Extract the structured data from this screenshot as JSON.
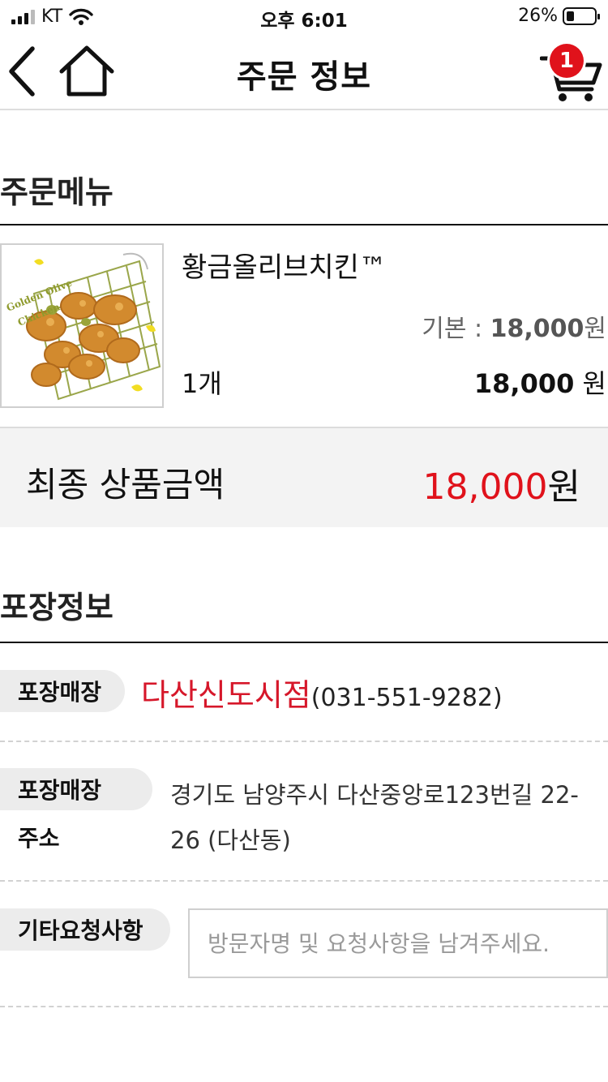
{
  "status_bar": {
    "carrier": "KT",
    "time": "오후 6:01",
    "battery_percent": "26%",
    "battery_level": 0.26
  },
  "header": {
    "title": "주문 정보",
    "cart_count": "1",
    "icons": {
      "back": "chevron-left-icon",
      "home": "home-icon",
      "cart": "cart-icon"
    }
  },
  "order_menu": {
    "title": "주문메뉴",
    "item": {
      "image_text_line1": "Golden Olive",
      "image_text_line2": "Chicken",
      "name": "황금올리브치킨™",
      "base_label": "기본 : ",
      "base_price": "18,000",
      "base_unit": "원",
      "quantity": "1개",
      "price": "18,000",
      "price_unit": " 원"
    }
  },
  "total": {
    "label": "최종 상품금액",
    "amount": "18,000",
    "unit": "원"
  },
  "pickup": {
    "title": "포장정보",
    "store_label": "포장매장",
    "store_name": "다산신도시점",
    "store_phone": "(031-551-9282)",
    "address_label_1": "포장매장",
    "address_label_2": "주소",
    "address": "경기도 남양주시 다산중앙로123번길 22-26 (다산동)",
    "request_label": "기타요청사항",
    "request_placeholder": "방문자명 및 요청사항을 남겨주세요.",
    "request_value": ""
  },
  "colors": {
    "accent_red": "#e0121b",
    "store_red": "#d6172a",
    "pill_gray": "#ececec",
    "total_bg": "#f3f3f3"
  }
}
